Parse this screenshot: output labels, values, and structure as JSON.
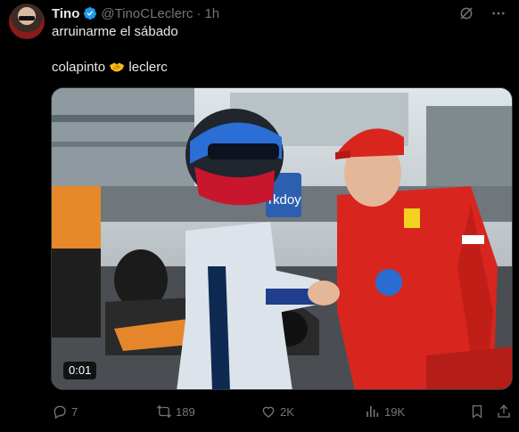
{
  "tweet": {
    "author_name": "Tino",
    "handle": "@TinoCLeclerc",
    "separator": "·",
    "time": "1h",
    "text_line1": "arruinarme el sábado",
    "text_line2_before": "colapinto",
    "text_line2_after": "leclerc",
    "emoji": "handshake-emoji"
  },
  "media": {
    "duration": "0:01",
    "sign_text": "rkdoy"
  },
  "actions": {
    "replies": "7",
    "reposts": "189",
    "likes": "2K",
    "views": "19K"
  },
  "colors": {
    "background": "#000000",
    "text": "#e7e9ea",
    "muted": "#71767b",
    "verified": "#1d9bf0",
    "ferrari_red": "#d8261f"
  }
}
